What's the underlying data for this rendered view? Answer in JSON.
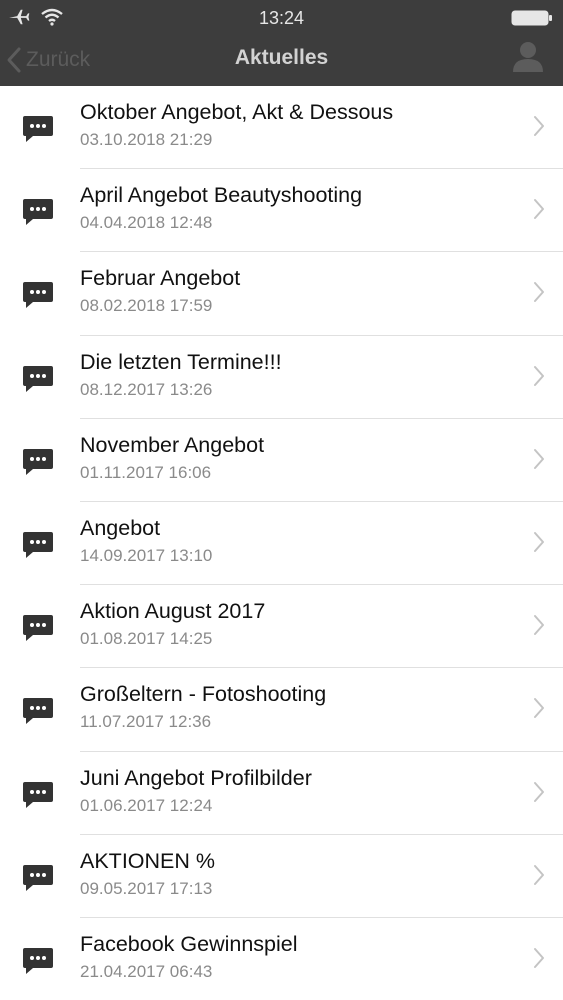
{
  "status_bar": {
    "time": "13:24",
    "icons": [
      "airplane-icon",
      "wifi-icon",
      "battery-icon"
    ]
  },
  "nav": {
    "back_label": "Zurück",
    "title": "Aktuelles",
    "right_icon": "person-icon"
  },
  "items": [
    {
      "title": "Oktober Angebot, Akt & Dessous",
      "date": "03.10.2018 21:29"
    },
    {
      "title": "April Angebot Beautyshooting",
      "date": "04.04.2018 12:48"
    },
    {
      "title": "Februar Angebot",
      "date": "08.02.2018 17:59"
    },
    {
      "title": "Die letzten Termine!!!",
      "date": "08.12.2017 13:26"
    },
    {
      "title": "November Angebot",
      "date": "01.11.2017 16:06"
    },
    {
      "title": "Angebot",
      "date": "14.09.2017 13:10"
    },
    {
      "title": "Aktion August 2017",
      "date": "01.08.2017 14:25"
    },
    {
      "title": "Großeltern - Fotoshooting",
      "date": "11.07.2017 12:36"
    },
    {
      "title": "Juni Angebot Profilbilder",
      "date": "01.06.2017 12:24"
    },
    {
      "title": "AKTIONEN %",
      "date": "09.05.2017 17:13"
    },
    {
      "title": "Facebook Gewinnspiel",
      "date": "21.04.2017 06:43"
    }
  ],
  "colors": {
    "bar_background": "#3d3d3d",
    "title_text": "#111111",
    "date_text": "#8a8a8a",
    "icon": "#333333",
    "chevron": "#c4c4c4"
  }
}
